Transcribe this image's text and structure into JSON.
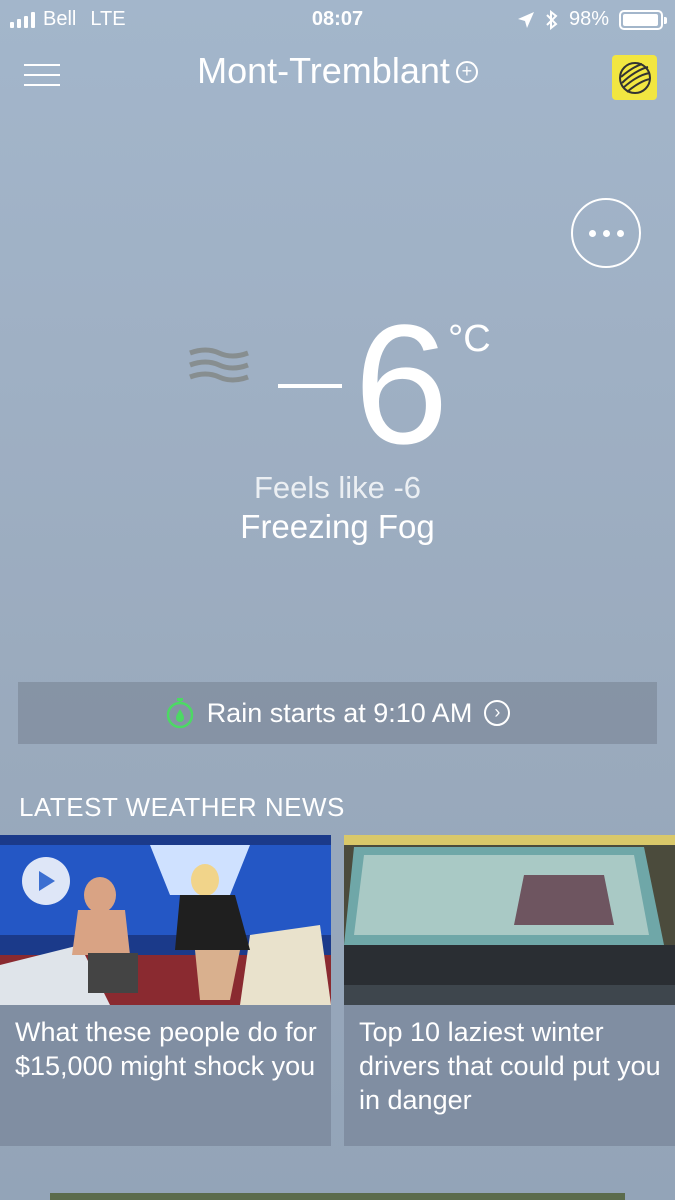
{
  "status_bar": {
    "carrier": "Bell",
    "network": "LTE",
    "time": "08:07",
    "battery": "98%",
    "battery_level": 0.98
  },
  "header": {
    "location": "Mont-Tremblant",
    "add_icon": "plus-circle-icon",
    "menu_icon": "hamburger-icon",
    "logo_icon": "globe-logo-icon",
    "logo_color": "#f2e641"
  },
  "current": {
    "temperature": "6",
    "unit": "°C",
    "feels_like": "Feels like -6",
    "condition": "Freezing Fog",
    "condition_icon": "fog-icon"
  },
  "rain_alert": {
    "text": "Rain starts at 9:10 AM",
    "icon": "stopwatch-icon",
    "icon_color": "#4cd964"
  },
  "news": {
    "heading": "LATEST WEATHER NEWS",
    "items": [
      {
        "headline": "What these people do for $15,000 might shock you",
        "has_video": true
      },
      {
        "headline": "Top 10 laziest winter drivers that could put you in danger",
        "has_video": false
      }
    ]
  }
}
